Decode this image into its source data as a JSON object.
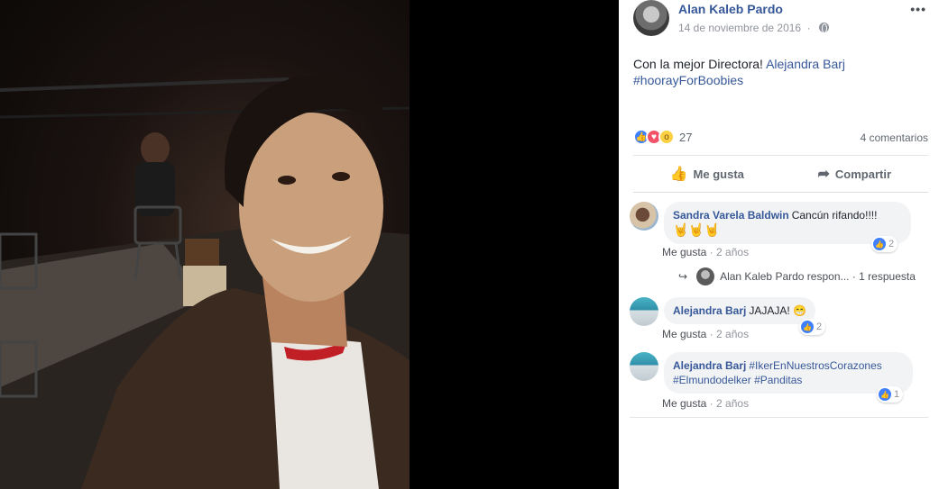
{
  "post": {
    "author": "Alan Kaleb Pardo",
    "date": "14 de noviembre de 2016",
    "more_icon": "more-dots-icon",
    "text_prefix": "Con la mejor Directora! ",
    "mention": "Alejandra Barj",
    "hashtag": "#hoorayForBoobies",
    "reaction_count": "27",
    "comments_count": "4 comentarios",
    "like_label": "Me gusta",
    "share_label": "Compartir"
  },
  "comments": [
    {
      "author": "Sandra Varela Baldwin",
      "text": "Cancún rifando!!!!",
      "emoji_line": "🤘🤘🤘",
      "likes": "2",
      "like_label": "Me gusta",
      "age": "2 años"
    },
    {
      "author": "Alejandra Barj",
      "text": "JAJAJA!",
      "emoji": "😁",
      "likes": "2",
      "like_label": "Me gusta",
      "age": "2 años"
    },
    {
      "author": "Alejandra Barj",
      "line1": "#IkerEnNuestrosCorazones",
      "line2a": "#Elmundodelker",
      "line2b": "#Panditas",
      "likes": "1",
      "like_label": "Me gusta",
      "age": "2 años"
    }
  ],
  "reply": {
    "author_text": "Alan Kaleb Pardo respon...",
    "count": "1 respuesta"
  },
  "colors": {
    "link": "#365899",
    "like_blue": "#4080ff",
    "love_red": "#f25268",
    "wow_yellow": "#fcd244"
  }
}
